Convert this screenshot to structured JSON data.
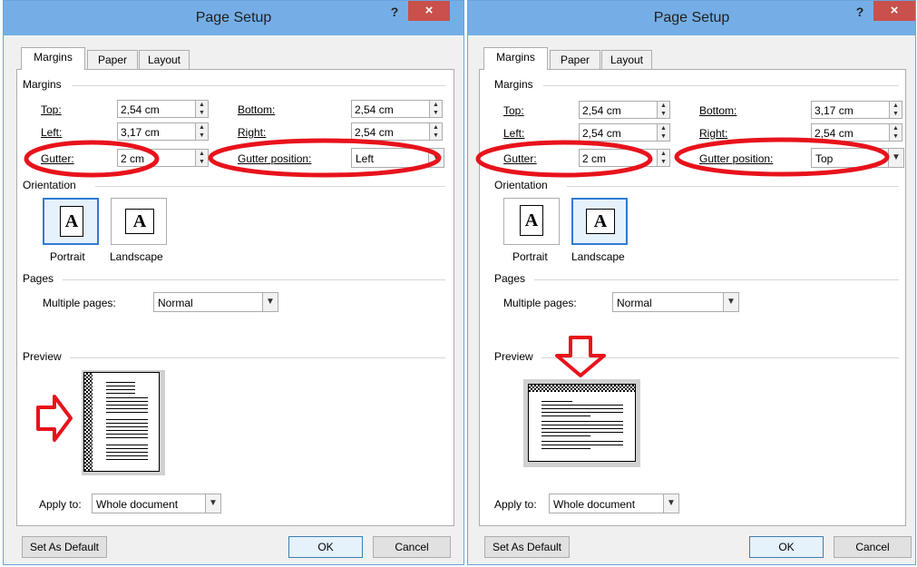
{
  "colors": {
    "accent": "#2f7bd2",
    "annotation_red": "#e8121b",
    "close_red": "#c9504b"
  },
  "dialogs": [
    {
      "title": "Page Setup",
      "help_label": "?",
      "close_label": "×",
      "tabs": [
        "Margins",
        "Paper",
        "Layout"
      ],
      "margins_section": "Margins",
      "top_label": "Top:",
      "top_value": "2,54 cm",
      "bottom_label": "Bottom:",
      "bottom_value": "2,54 cm",
      "left_label": "Left:",
      "left_value": "3,17 cm",
      "right_label": "Right:",
      "right_value": "2,54 cm",
      "gutter_label": "Gutter:",
      "gutter_value": "2 cm",
      "gutter_position_label": "Gutter position:",
      "gutter_position_value": "Left",
      "orientation_section": "Orientation",
      "portrait_label": "Portrait",
      "landscape_label": "Landscape",
      "selected_orientation": "portrait",
      "pages_section": "Pages",
      "multiple_pages_label": "Multiple pages:",
      "multiple_pages_value": "Normal",
      "preview_section": "Preview",
      "apply_to_label": "Apply to:",
      "apply_to_value": "Whole document",
      "set_default_label": "Set As Default",
      "ok_label": "OK",
      "cancel_label": "Cancel"
    },
    {
      "title": "Page Setup",
      "help_label": "?",
      "close_label": "×",
      "tabs": [
        "Margins",
        "Paper",
        "Layout"
      ],
      "margins_section": "Margins",
      "top_label": "Top:",
      "top_value": "2,54 cm",
      "bottom_label": "Bottom:",
      "bottom_value": "3,17 cm",
      "left_label": "Left:",
      "left_value": "2,54 cm",
      "right_label": "Right:",
      "right_value": "2,54 cm",
      "gutter_label": "Gutter:",
      "gutter_value": "2 cm",
      "gutter_position_label": "Gutter position:",
      "gutter_position_value": "Top",
      "orientation_section": "Orientation",
      "portrait_label": "Portrait",
      "landscape_label": "Landscape",
      "selected_orientation": "landscape",
      "pages_section": "Pages",
      "multiple_pages_label": "Multiple pages:",
      "multiple_pages_value": "Normal",
      "preview_section": "Preview",
      "apply_to_label": "Apply to:",
      "apply_to_value": "Whole document",
      "set_default_label": "Set As Default",
      "ok_label": "OK",
      "cancel_label": "Cancel"
    }
  ]
}
